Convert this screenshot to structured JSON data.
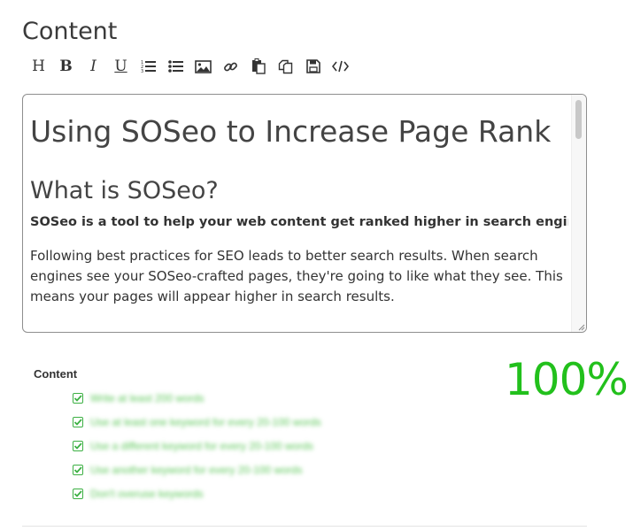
{
  "section": {
    "title": "Content"
  },
  "toolbar": {
    "buttons": [
      {
        "name": "heading",
        "label": "H"
      },
      {
        "name": "bold",
        "label": "B"
      },
      {
        "name": "italic",
        "label": "I"
      },
      {
        "name": "underline",
        "label": "U"
      },
      {
        "name": "ordered-list",
        "icon": "ordered-list-icon"
      },
      {
        "name": "unordered-list",
        "icon": "unordered-list-icon"
      },
      {
        "name": "image",
        "icon": "image-icon"
      },
      {
        "name": "link",
        "icon": "link-icon"
      },
      {
        "name": "paste",
        "icon": "paste-icon"
      },
      {
        "name": "copy",
        "icon": "copy-icon"
      },
      {
        "name": "save",
        "icon": "save-icon"
      },
      {
        "name": "code",
        "icon": "code-icon"
      }
    ]
  },
  "editor": {
    "h1": "Using SOSeo to Increase Page Rank",
    "h2": "What is SOSeo?",
    "lead": "SOSeo is a tool to help your web content get ranked higher in search engines.",
    "paragraph": "Following best practices for SEO leads to better search results. When search engines see your SOSeo-crafted pages, they're going to like what they see. This means your pages will appear higher in search results."
  },
  "analysis": {
    "label": "Content",
    "score": "100%",
    "score_color": "#22c01c",
    "checks": [
      "Write at least 200 words",
      "Use at least one keyword for every 20-100 words",
      "Use a different keyword for every 20-100 words",
      "Use another keyword for every 20-100 words",
      "Don't overuse keywords"
    ]
  }
}
